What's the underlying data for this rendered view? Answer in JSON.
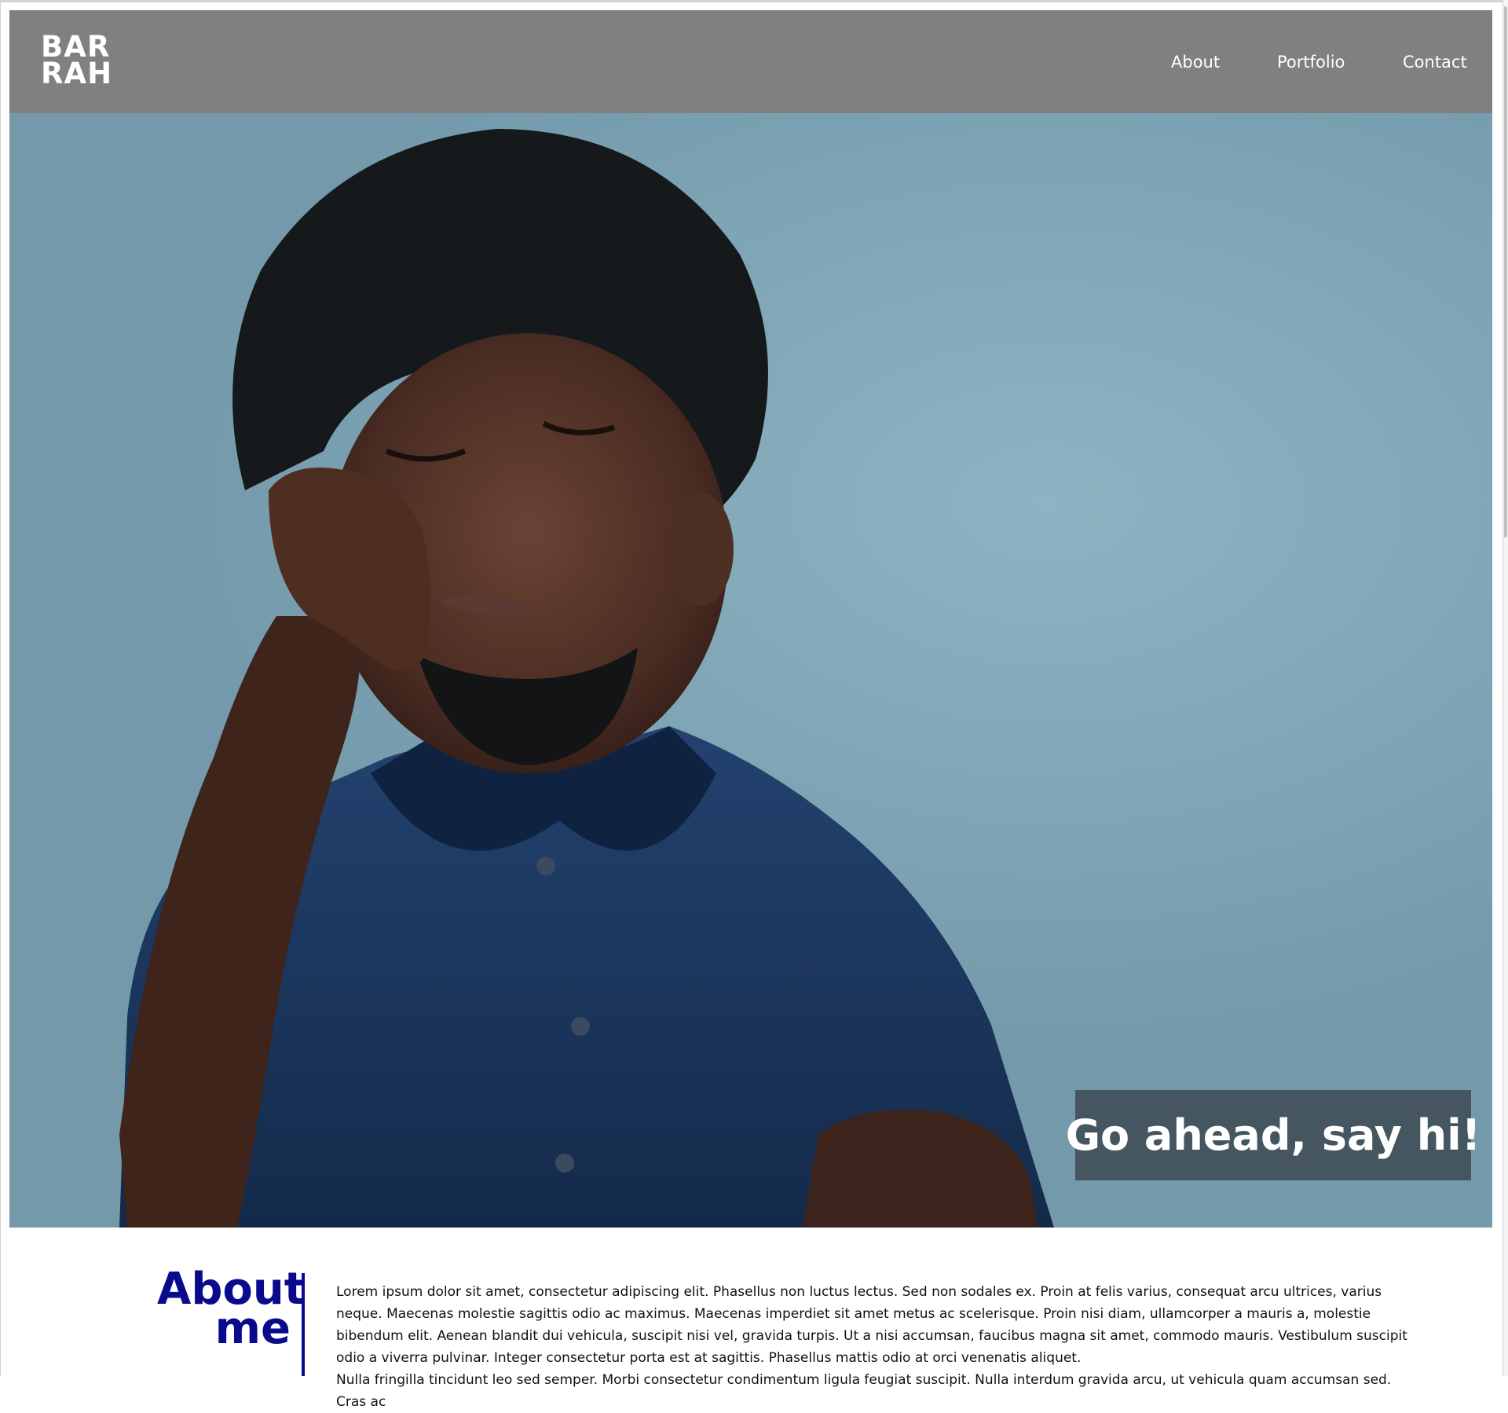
{
  "header": {
    "logo_line1": "BAR",
    "logo_line2": "RAH",
    "nav": {
      "about": "About",
      "portfolio": "Portfolio",
      "contact": "Contact"
    },
    "background": "#808080"
  },
  "hero": {
    "image_subject": "portrait photo",
    "cta_label": "Go ahead, say hi!",
    "wall_color": "#84a9b9",
    "shirt_color": "#1e3a63"
  },
  "about": {
    "heading_line1": "About",
    "heading_line2": "me",
    "accent": "#0a0a8c",
    "paragraph1": "Lorem ipsum dolor sit amet, consectetur adipiscing elit. Phasellus non luctus lectus. Sed non sodales ex. Proin at felis varius, consequat arcu ultrices, varius neque. Maecenas molestie sagittis odio ac maximus. Maecenas imperdiet sit amet metus ac scelerisque. Proin nisi diam, ullamcorper a mauris a, molestie bibendum elit. Aenean blandit dui vehicula, suscipit nisi vel, gravida turpis. Ut a nisi accumsan, faucibus magna sit amet, commodo mauris. Vestibulum suscipit odio a viverra pulvinar. Integer consectetur porta est at sagittis. Phasellus mattis odio at orci venenatis aliquet.",
    "paragraph2": "Nulla fringilla tincidunt leo sed semper. Morbi consectetur condimentum ligula feugiat suscipit. Nulla interdum gravida arcu, ut vehicula quam accumsan sed. Cras ac"
  }
}
